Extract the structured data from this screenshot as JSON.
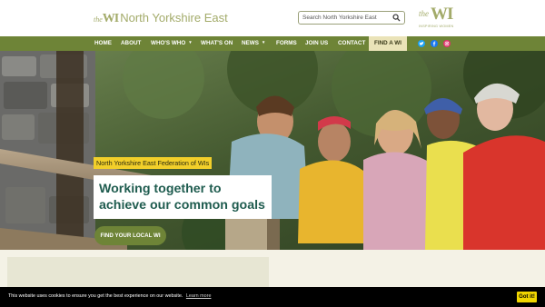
{
  "header": {
    "logo_the": "the",
    "logo_wi": "WI",
    "logo_name": "North Yorkshire East",
    "search_placeholder": "Search North Yorkshire East",
    "brand_the": "the",
    "brand_wi": "WI",
    "brand_tagline": "INSPIRING WOMEN"
  },
  "nav": {
    "items": [
      {
        "label": "Home"
      },
      {
        "label": "About"
      },
      {
        "label": "Who's Who",
        "dropdown": true
      },
      {
        "label": "What's On"
      },
      {
        "label": "News",
        "dropdown": true
      },
      {
        "label": "Forms"
      },
      {
        "label": "Join Us"
      },
      {
        "label": "Contact"
      }
    ],
    "find_label": "FIND A WI",
    "caret": "▼",
    "social": [
      {
        "name": "twitter",
        "color": "#1da1f2"
      },
      {
        "name": "facebook",
        "color": "#1877f2"
      },
      {
        "name": "instagram",
        "color": "#e1306c"
      }
    ]
  },
  "hero": {
    "tag": "North Yorkshire East Federation of WIs",
    "headline_line1": "Working together to",
    "headline_line2": "achieve our common goals",
    "button_label": "FIND YOUR LOCAL WI"
  },
  "cookie": {
    "text": "This website uses cookies to ensure you get the best experience on our website.",
    "link": "Learn more",
    "button": "Got it!"
  },
  "colors": {
    "nav_green": "#6e8437",
    "headline_green": "#1f5c4f",
    "tag_yellow": "#f2cf2a",
    "logo_olive": "#a3ab6a",
    "find_bg": "#eae3b8",
    "cookie_button": "#f1d600"
  }
}
